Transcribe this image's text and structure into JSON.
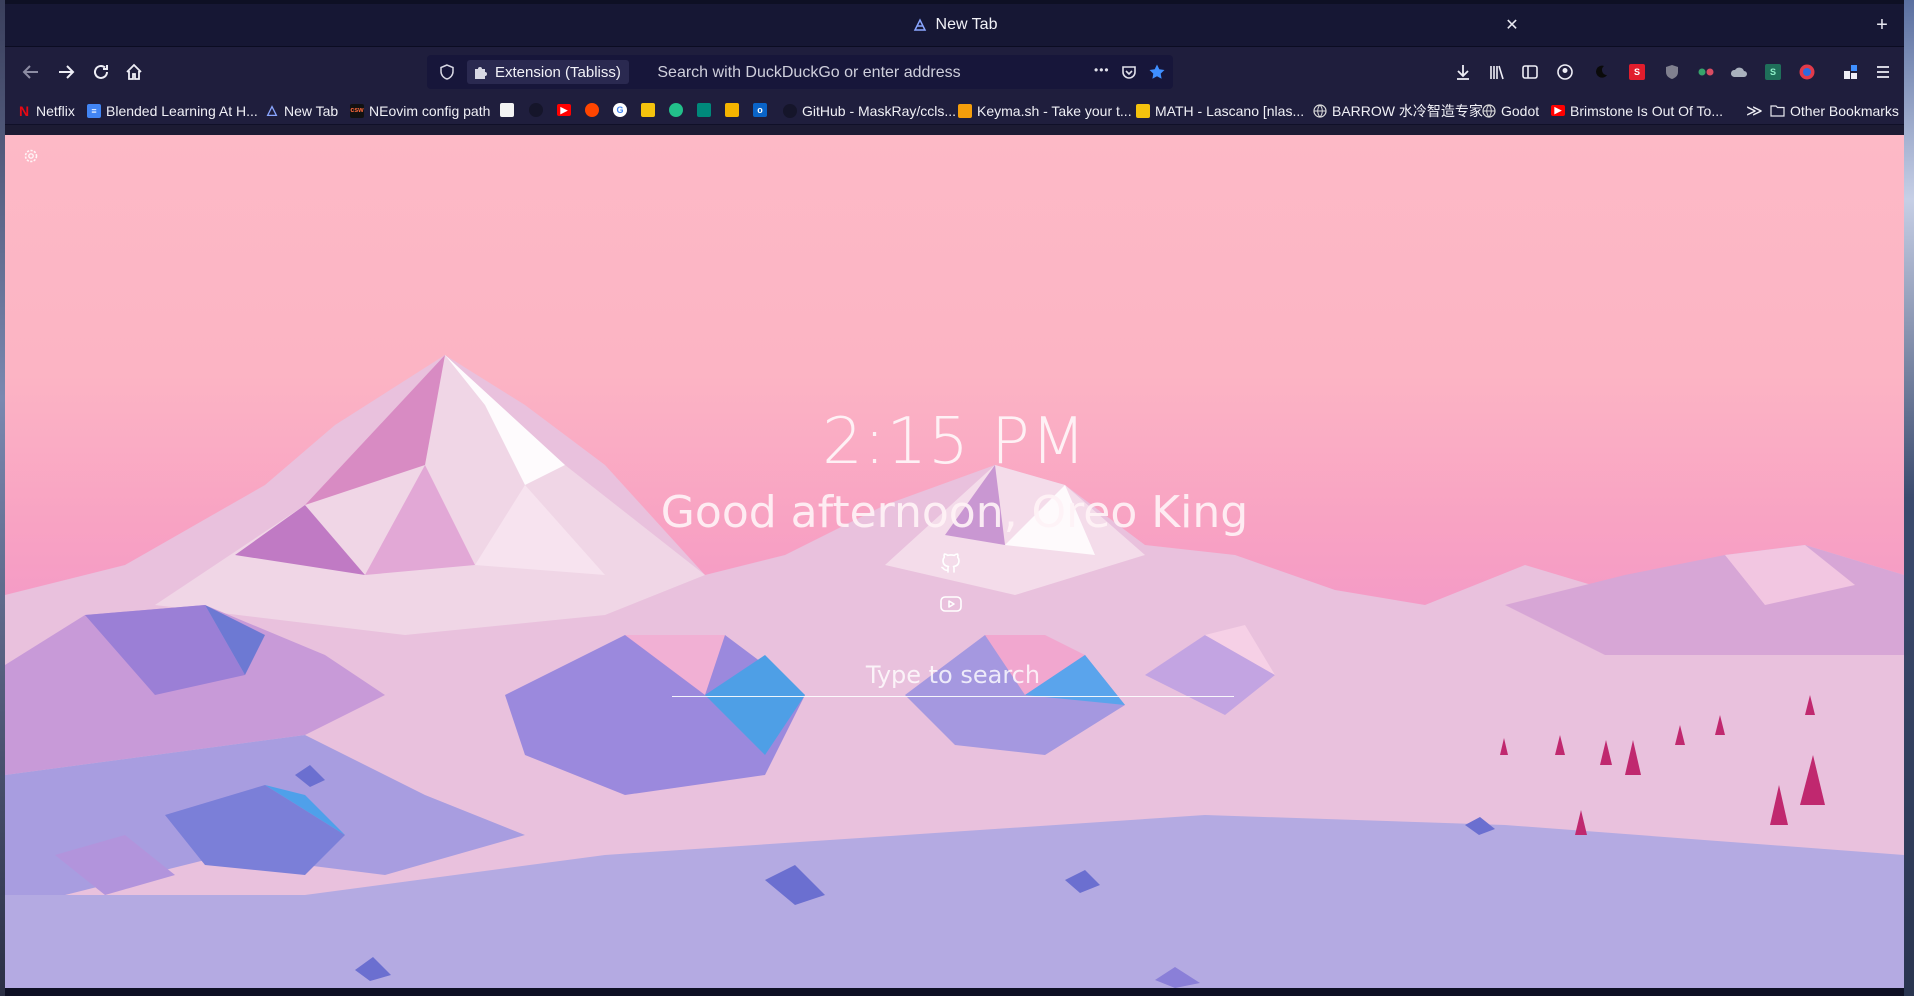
{
  "browser": {
    "tab_title": "New Tab",
    "new_tab_symbol": "+",
    "close_symbol": "✕"
  },
  "urlbar": {
    "identity_label": "Extension (Tabliss)",
    "placeholder": "Search with DuckDuckGo or enter address",
    "page_actions_symbol": "•••"
  },
  "bookmarks": {
    "items": [
      {
        "label": "Netflix",
        "icon": "netflix-icon",
        "color": "#e50914"
      },
      {
        "label": "Blended Learning At H...",
        "icon": "docs-icon",
        "color": "#4285f4"
      },
      {
        "label": "New Tab",
        "icon": "tabliss-icon",
        "color": "#8aa0ff"
      },
      {
        "label": "NEovim config path",
        "icon": "csw-icon",
        "color": "#111111"
      },
      {
        "label": "GitHub - MaskRay/ccls...",
        "icon": "github-icon",
        "color": "#111111"
      },
      {
        "label": "Keyma.sh - Take your t...",
        "icon": "keymash-icon",
        "color": "#f59e0b"
      },
      {
        "label": "MATH - Lascano [nlas...",
        "icon": "classroom-icon",
        "color": "#f4c20d"
      },
      {
        "label": "BARROW 水冷智造专家",
        "icon": "globe-icon",
        "color": "#dddddd"
      },
      {
        "label": "Godot",
        "icon": "globe-icon",
        "color": "#dddddd"
      },
      {
        "label": "Brimstone Is Out Of To...",
        "icon": "youtube-icon",
        "color": "#ff0000"
      }
    ],
    "overflow_symbol": "≫",
    "other_label": "Other Bookmarks"
  },
  "newtab": {
    "time": "2:15 PM",
    "greeting": "Good afternoon, Oreo King",
    "search_placeholder": "Type to search",
    "links": [
      "github-icon",
      "youtube-icon"
    ]
  }
}
